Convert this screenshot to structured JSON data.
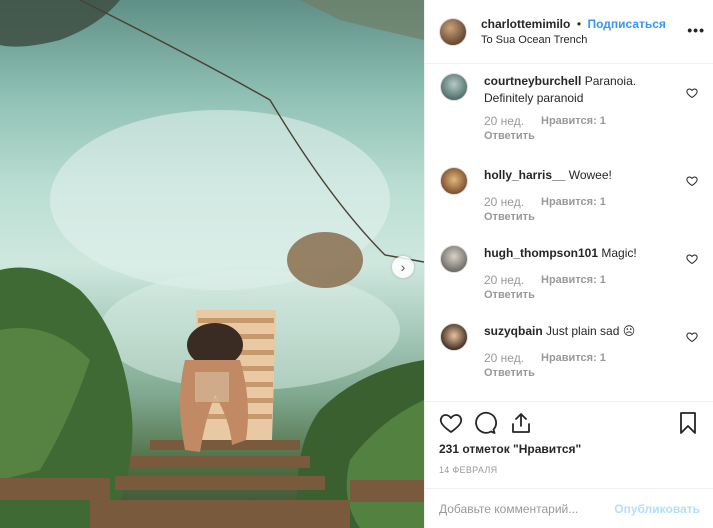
{
  "post": {
    "username": "charlottemimilo",
    "separator": "•",
    "follow_label": "Подписаться",
    "location": "To Sua Ocean Trench",
    "more_icon": "more-horizontal-icon"
  },
  "comments": [
    {
      "username": "courtneyburchell",
      "text": "Paranoia. Definitely paranoid",
      "time": "20 нед.",
      "likes": "Нравится: 1",
      "reply": "Ответить"
    },
    {
      "username": "holly_harris__",
      "text": "Wowee!",
      "time": "20 нед.",
      "likes": "Нравится: 1",
      "reply": "Ответить"
    },
    {
      "username": "hugh_thompson101",
      "text": "Magic!",
      "time": "20 нед.",
      "likes": "Нравится: 1",
      "reply": "Ответить"
    },
    {
      "username": "suzyqbain",
      "text": "Just plain sad ☹",
      "time": "20 нед.",
      "likes": "Нравится: 1",
      "reply": "Ответить"
    }
  ],
  "actions": {
    "like_icon": "heart-icon",
    "comment_icon": "comment-icon",
    "share_icon": "share-icon",
    "save_icon": "bookmark-icon",
    "likes_count": "231 отметок \"Нравится\"",
    "date": "14 ФЕВРАЛЯ"
  },
  "add_comment": {
    "placeholder": "Добавьте комментарий...",
    "publish_label": "Опубликовать"
  },
  "colors": {
    "link": "#3897f0",
    "publish_disabled": "#b2dffc",
    "muted": "#999999"
  }
}
